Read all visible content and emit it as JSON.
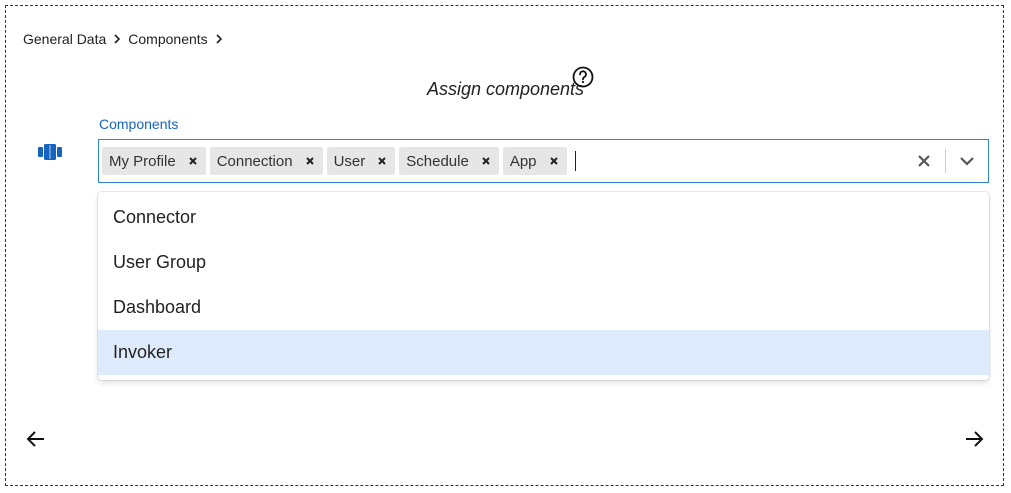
{
  "breadcrumb": {
    "items": [
      "General Data",
      "Components"
    ]
  },
  "page": {
    "title": "Assign components"
  },
  "field": {
    "label": "Components",
    "selected_chips": [
      "My Profile",
      "Connection",
      "User",
      "Schedule",
      "App"
    ]
  },
  "menu": {
    "options": [
      "Connector",
      "User Group",
      "Dashboard",
      "Invoker"
    ],
    "highlighted_option": "Invoker"
  },
  "colors": {
    "label_blue": "#1565c0",
    "focus_border": "#2e84d6",
    "highlight_bg": "#deebfc",
    "chip_bg": "#e6e6e6",
    "icon_blue": "#1565c0"
  },
  "icons": {
    "help": "question-circle-icon",
    "component": "component-stack-icon",
    "chip_remove": "close-icon",
    "clear": "close-icon",
    "dropdown": "chevron-down-icon",
    "back": "arrow-left-icon",
    "next": "arrow-right-icon",
    "breadcrumb_sep": "chevron-right-icon"
  }
}
